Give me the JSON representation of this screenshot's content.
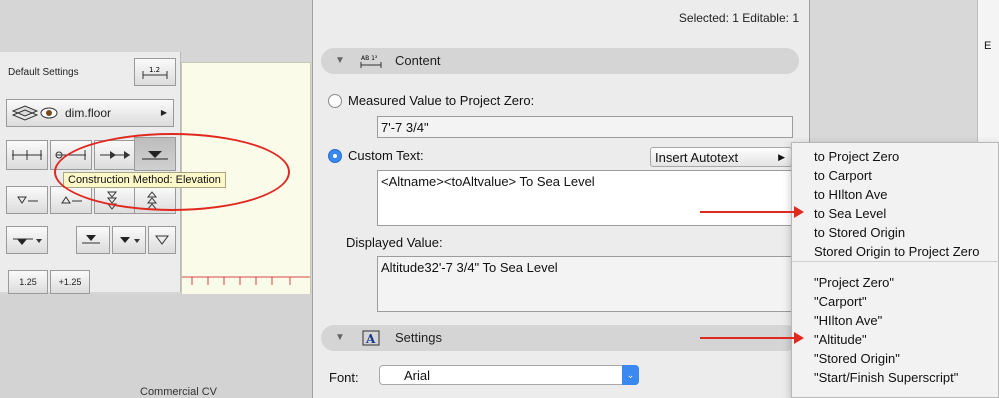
{
  "palette": {
    "default_settings_label": "Default Settings",
    "layer_name": "dim.floor",
    "tooltip": "Construction Method: Elevation",
    "scale_buttons": [
      "1.25",
      "+1.25"
    ],
    "dim_icon_label": "1.2"
  },
  "taskbar": {
    "text": "Commercial CV"
  },
  "dialog": {
    "selected_info": "Selected: 1 Editable: 1",
    "content_section": {
      "title": "Content",
      "icon": "autotext-dimension-icon"
    },
    "measured_option_label": "Measured Value to Project Zero:",
    "measured_value": "7'-7 3/4\"",
    "custom_text_label": "Custom Text:",
    "insert_autotext_label": "Insert Autotext",
    "custom_text_value": "<Altname><toAltvalue> To Sea Level",
    "displayed_value_label": "Displayed Value:",
    "displayed_value": "Altitude32'-7 3/4\" To Sea Level",
    "settings_section": {
      "title": "Settings",
      "icon": "text-settings-icon"
    },
    "font_label": "Font:",
    "font_value": "Arial",
    "measured_selected": false,
    "custom_selected": true
  },
  "autotext_menu": {
    "group1": [
      "to Project Zero",
      "to Carport",
      "to HIlton Ave",
      "to Sea Level",
      "to Stored Origin",
      "Stored Origin to Project Zero"
    ],
    "group2": [
      "\"Project Zero\"",
      "\"Carport\"",
      "\"HIlton Ave\"",
      "\"Altitude\"",
      "\"Stored Origin\"",
      "\"Start/Finish Superscript\""
    ]
  },
  "right_strip": {
    "letter": "E"
  },
  "colors": {
    "accent": "#3b88f0",
    "annotation_red": "#e02a20",
    "tooltip_bg": "#fdf8c8",
    "canvas_bg": "#fbfbe9"
  }
}
